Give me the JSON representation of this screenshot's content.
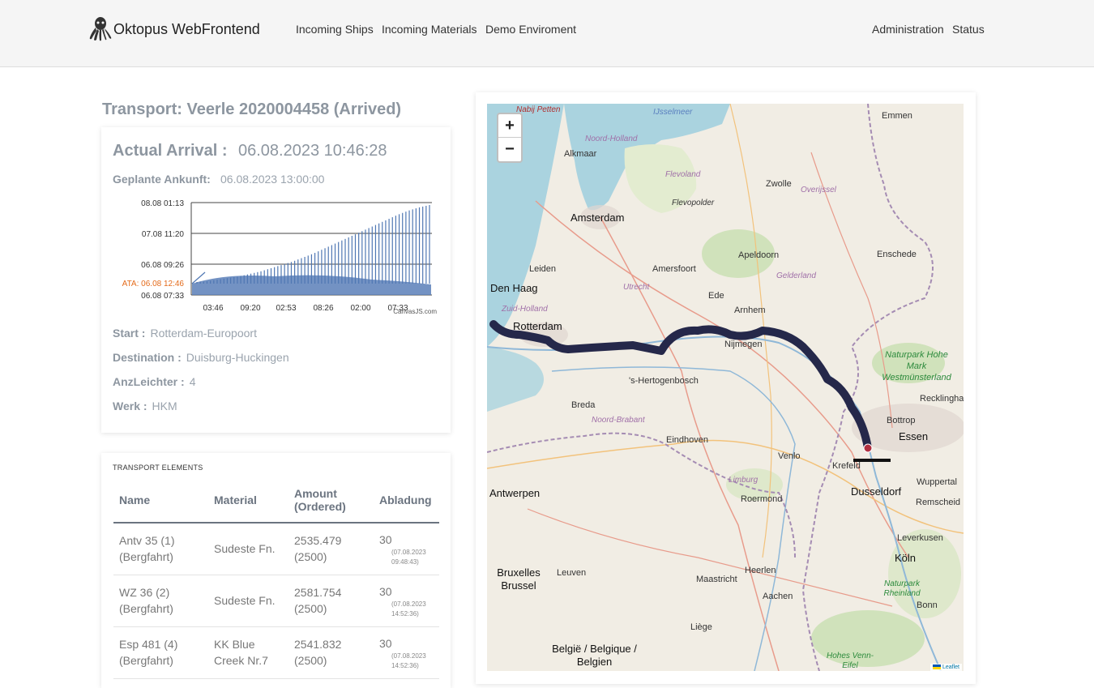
{
  "navbar": {
    "brand": "Oktopus WebFrontend",
    "links": [
      "Incoming Ships",
      "Incoming Materials",
      "Demo Enviroment"
    ],
    "right_links": [
      "Administration",
      "Status"
    ]
  },
  "transport": {
    "title": "Transport: Veerle 2020004458 (Arrived)",
    "actual_arrival_label": "Actual Arrival :",
    "actual_arrival_value": "06.08.2023 10:46:28",
    "planned_label": "Geplante Ankunft:",
    "planned_value": "06.08.2023 13:00:00",
    "start_label": "Start :",
    "start_value": "Rotterdam-Europoort",
    "destination_label": "Destination :",
    "destination_value": "Duisburg-Huckingen",
    "anzleichter_label": "AnzLeichter :",
    "anzleichter_value": "4",
    "werk_label": "Werk :",
    "werk_value": "HKM"
  },
  "chart_data": {
    "type": "area",
    "y_tick_labels": [
      "08.08 01:13",
      "07.08 11:20",
      "06.08 09:26",
      "06.08 07:33"
    ],
    "ata_label": "ATA: 06.08 12:46",
    "x_tick_labels": [
      "03:46",
      "09:20",
      "02:53",
      "08:26",
      "02:00",
      "07:33"
    ],
    "credit": "CanvasJS.com",
    "colors": {
      "area": "#5b7fb9",
      "bars": "#4f77b3",
      "ata": "#e46b1b"
    },
    "series": [
      {
        "values": [
          0.05,
          0.06,
          0.08,
          0.1,
          0.12,
          0.15,
          0.18,
          0.22,
          0.26,
          0.3,
          0.35,
          0.4,
          0.46,
          0.52,
          0.58,
          0.64,
          0.7,
          0.76,
          0.82,
          0.88,
          0.93,
          0.97,
          1.0
        ]
      }
    ]
  },
  "elements": {
    "title": "TRANSPORT ELEMENTS",
    "headers": [
      "Name",
      "Material",
      "Amount (Ordered)",
      "Abladung"
    ],
    "rows": [
      {
        "name": "Antv 35 (1) (Bergfahrt)",
        "material": "Sudeste Fn.",
        "amount": "2535.479 (2500)",
        "abladung": "30",
        "abladung_date": "(07.08.2023 09:48:43)"
      },
      {
        "name": "WZ 36 (2) (Bergfahrt)",
        "material": "Sudeste Fn.",
        "amount": "2581.754 (2500)",
        "abladung": "30",
        "abladung_date": "(07.08.2023 14:52:36)"
      },
      {
        "name": "Esp 481 (4) (Bergfahrt)",
        "material": "KK Blue Creek Nr.7",
        "amount": "2541.832 (2500)",
        "abladung": "30",
        "abladung_date": "(07.08.2023 14:52:36)"
      }
    ]
  },
  "map": {
    "zoom_in": "+",
    "zoom_out": "−",
    "attribution": "Leaflet",
    "labels": [
      "Nabij Petten",
      "IJsselmeer",
      "Emmen",
      "Noord-Holland",
      "Alkmaar",
      "Flevoland",
      "Flevopolder",
      "Zwolle",
      "Overijssel",
      "Amsterdam",
      "Leiden",
      "Apeldoorn",
      "Enschede",
      "Amersfoort",
      "Gelderland",
      "Den Haag",
      "Utrecht",
      "Ede",
      "Zuid-Holland",
      "Arnhem",
      "Rotterdam",
      "Nijmegen",
      "Naturpark Hohe Mark Westmünsterland",
      "Recklinghause",
      "'s-Hertogenbosch",
      "Breda",
      "Bottrop",
      "Noord-Brabant",
      "Eindhoven",
      "Essen",
      "Venlo",
      "Krefeld",
      "Antwerpen",
      "Limburg",
      "Dusseldorf",
      "Wuppertal",
      "Roermond",
      "Remscheid",
      "Leverkusen",
      "Köln",
      "Bruxelles Brussel",
      "Leuven",
      "Heerlen",
      "Maastricht",
      "Naturpark Rheinland",
      "Aachen",
      "Bonn",
      "Liège",
      "België / Belgique / Belgien",
      "Hohes Venn-Eifel"
    ]
  }
}
